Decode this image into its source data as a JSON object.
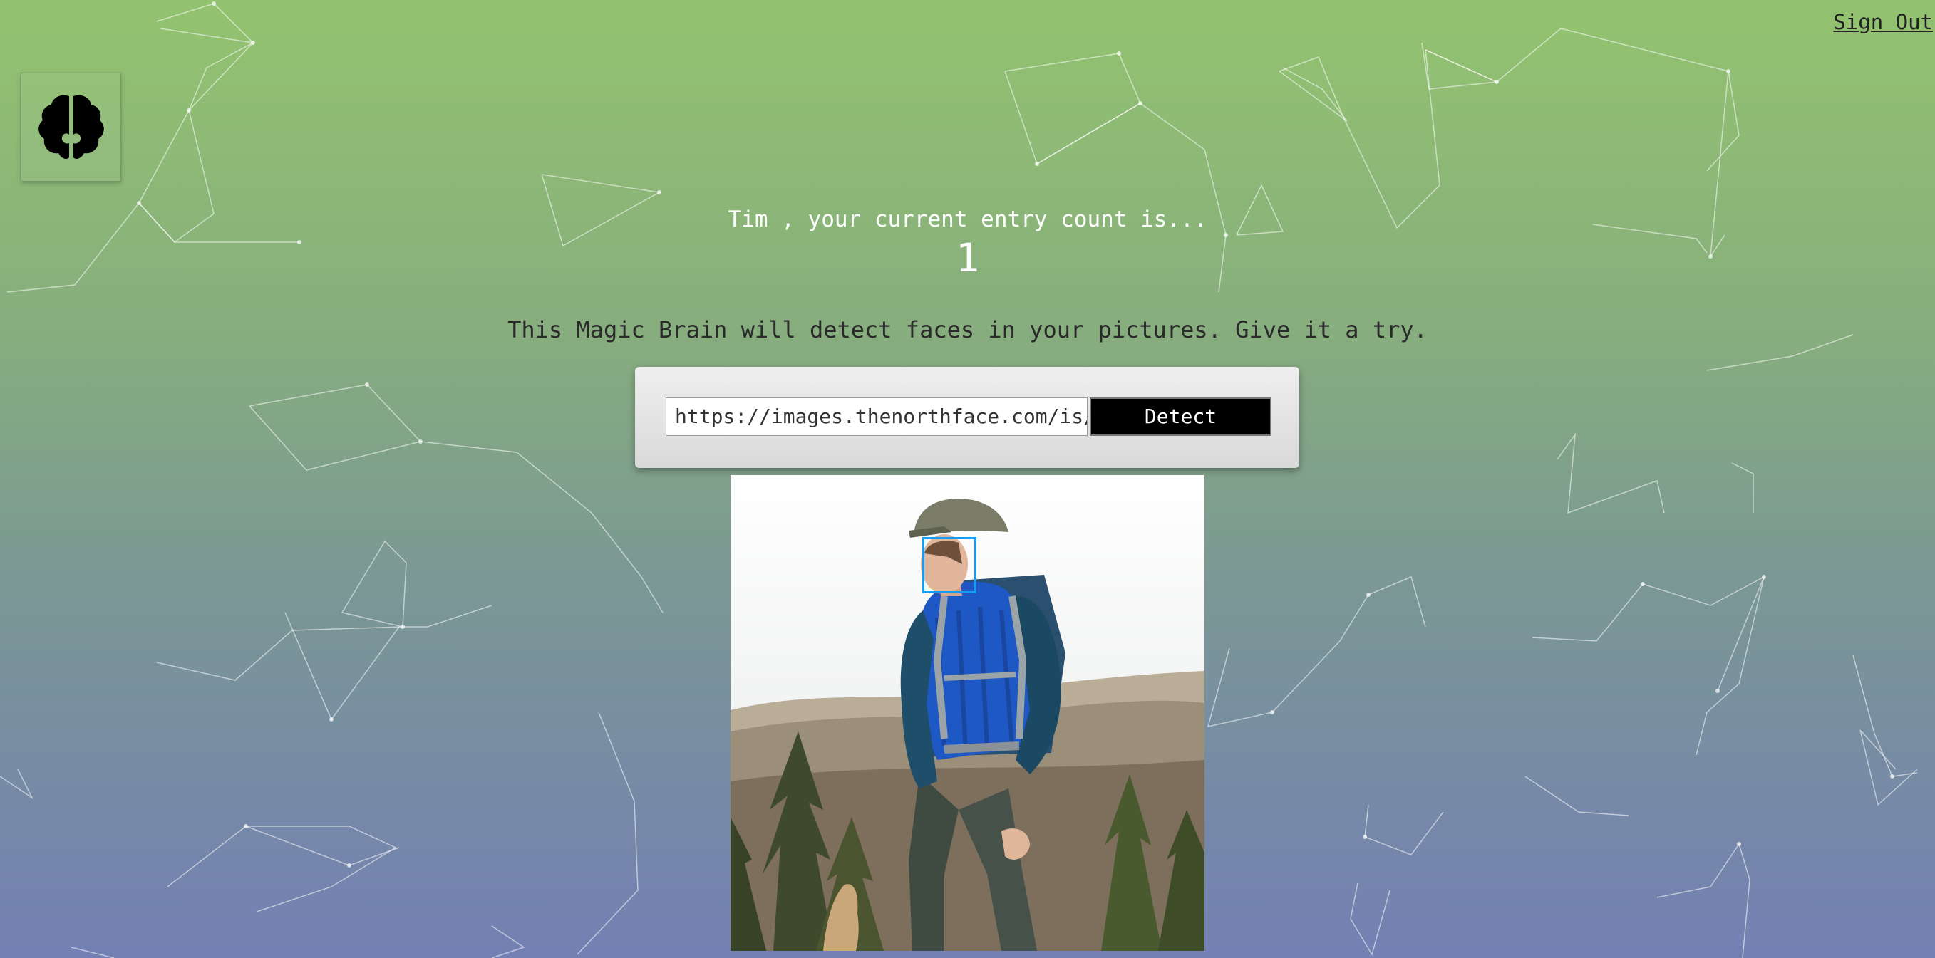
{
  "header": {
    "signout_label": "Sign Out",
    "logo_icon": "brain-icon"
  },
  "rank": {
    "greeting": "Tim , your current entry count is...",
    "count": "1"
  },
  "tagline": "This Magic Brain will detect faces in your pictures. Give it a try.",
  "form": {
    "url_value": "https://images.thenorthface.com/is/i",
    "detect_label": "Detect"
  },
  "colors": {
    "gradient_top": "#93c36f",
    "gradient_bottom": "#7380b4",
    "face_box": "#149df2",
    "button_bg": "#000000"
  }
}
